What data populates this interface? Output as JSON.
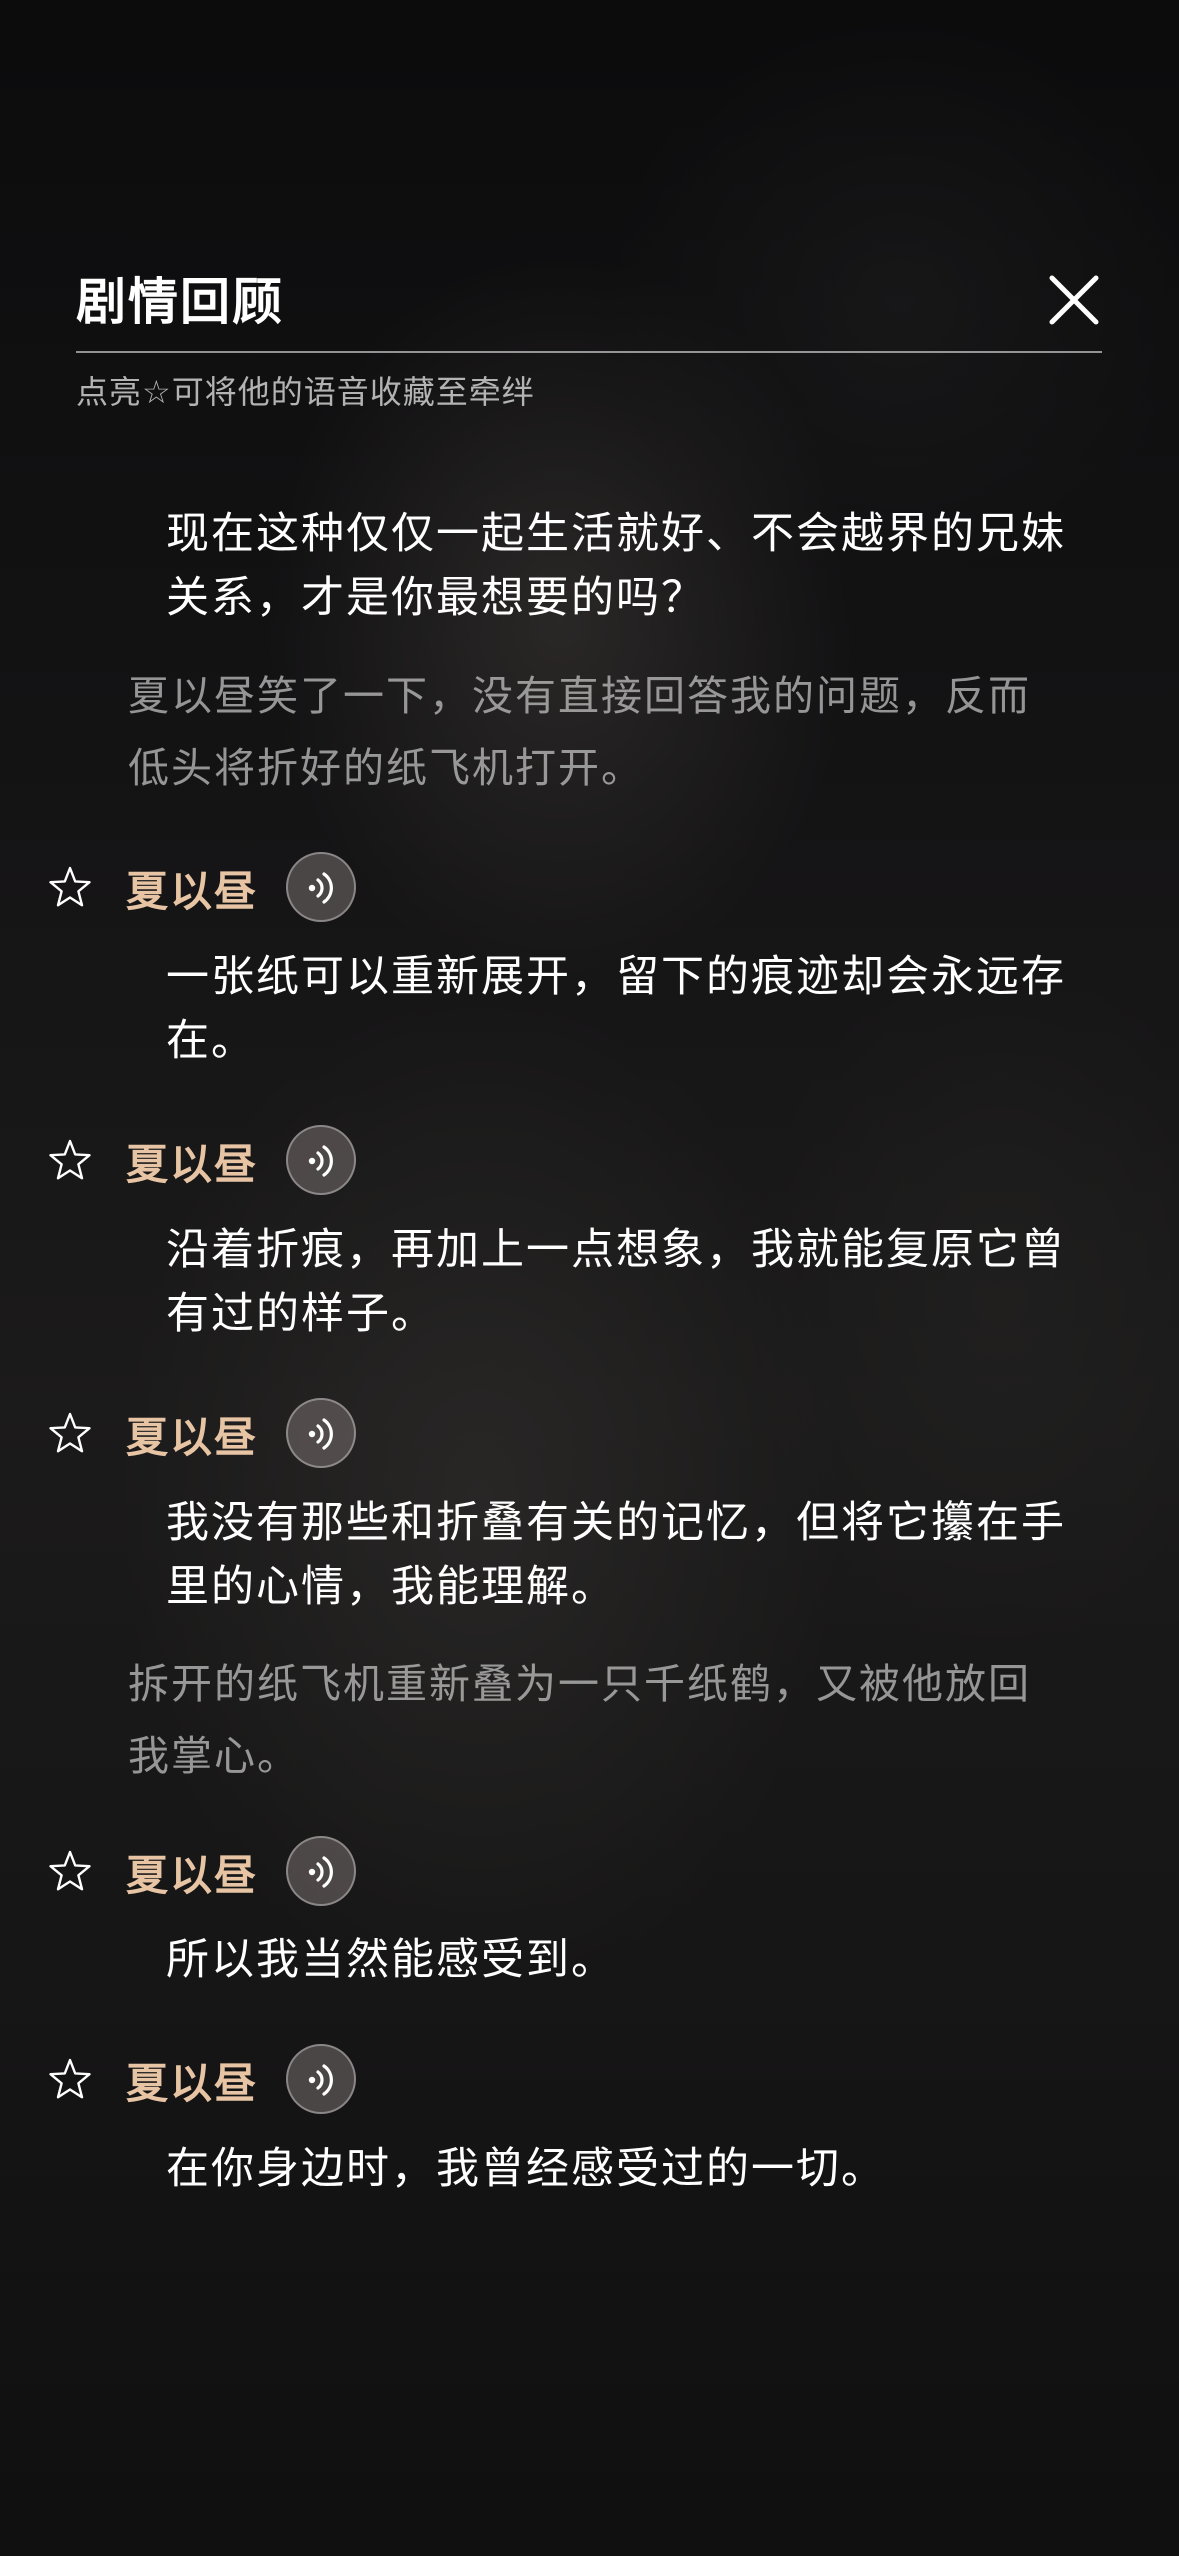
{
  "header": {
    "title": "剧情回顾",
    "hint": "点亮☆可将他的语音收藏至牵绊"
  },
  "entries": [
    {
      "type": "line",
      "text": "现在这种仅仅一起生活就好、不会越界的兄妹关系，才是你最想要的吗？"
    },
    {
      "type": "narration",
      "text": "夏以昼笑了一下，没有直接回答我的问题，反而低头将折好的纸飞机打开。"
    },
    {
      "type": "voice",
      "speaker": "夏以昼",
      "text": "一张纸可以重新展开，留下的痕迹却会永远存在。"
    },
    {
      "type": "voice",
      "speaker": "夏以昼",
      "text": "沿着折痕，再加上一点想象，我就能复原它曾有过的样子。"
    },
    {
      "type": "voice",
      "speaker": "夏以昼",
      "text": "我没有那些和折叠有关的记忆，但将它攥在手里的心情，我能理解。"
    },
    {
      "type": "narration",
      "text": "拆开的纸飞机重新叠为一只千纸鹤，又被他放回我掌心。"
    },
    {
      "type": "voice",
      "speaker": "夏以昼",
      "text": "所以我当然能感受到。"
    },
    {
      "type": "voice",
      "speaker": "夏以昼",
      "text": "在你身边时，我曾经感受过的一切。"
    }
  ],
  "icons": {
    "close": "close-icon",
    "star": "star-outline-icon",
    "voice": "voice-play-icon"
  },
  "colors": {
    "speaker": "#e7c4a4",
    "narration": "#c8c8c8",
    "dialogue": "#ffffff"
  }
}
